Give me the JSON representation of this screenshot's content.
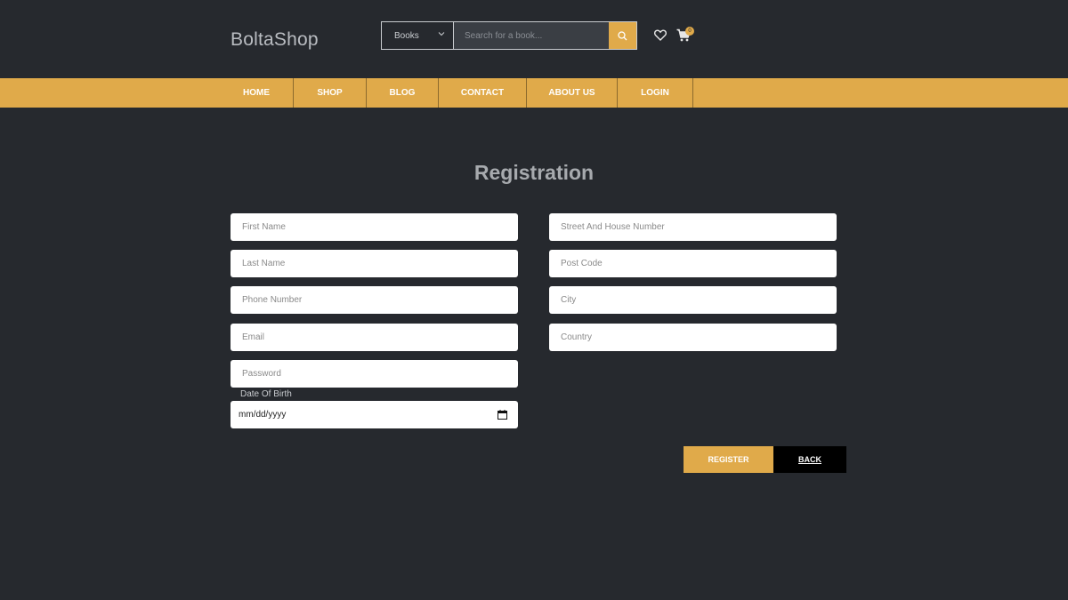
{
  "header": {
    "brand": "BoltaShop",
    "category_select": "Books",
    "search_placeholder": "Search for a book...",
    "cart_count": "0",
    "accent_color": "#e0aa4a"
  },
  "nav": {
    "items": [
      {
        "label": "HOME"
      },
      {
        "label": "SHOP"
      },
      {
        "label": "BLOG"
      },
      {
        "label": "CONTACT"
      },
      {
        "label": "ABOUT US"
      },
      {
        "label": "LOGIN"
      }
    ]
  },
  "form": {
    "title": "Registration",
    "left_fields": [
      {
        "placeholder": "First Name"
      },
      {
        "placeholder": "Last Name"
      },
      {
        "placeholder": "Phone Number"
      },
      {
        "placeholder": "Email"
      },
      {
        "placeholder": "Password"
      }
    ],
    "right_fields": [
      {
        "placeholder": "Street And House Number"
      },
      {
        "placeholder": "Post Code"
      },
      {
        "placeholder": "City"
      },
      {
        "placeholder": "Country"
      }
    ],
    "dob_label": "Date Of Birth",
    "dob_placeholder": "mm/dd/yyyy",
    "register_label": "REGISTER",
    "back_label": "BACK"
  }
}
